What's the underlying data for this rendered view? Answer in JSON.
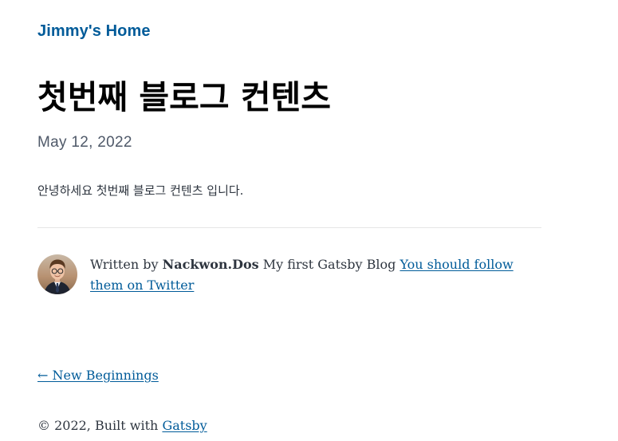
{
  "header": {
    "site_title": "Jimmy's Home"
  },
  "post": {
    "title": "첫번째 블로그 컨텐츠",
    "date": "May 12, 2022",
    "body": "안녕하세요 첫번째 블로그 컨텐츠 입니다."
  },
  "bio": {
    "avatar_icon": "author-avatar",
    "written_by": "Written by",
    "author": "Nackwon.Dos",
    "description": "My first Gatsby Blog",
    "twitter_link": "You should follow them on Twitter"
  },
  "nav": {
    "prev_link": "← New Beginnings"
  },
  "footer": {
    "copyright": "© 2022, Built with",
    "gatsby_link": "Gatsby"
  },
  "colors": {
    "link": "#005b99",
    "text": "#2e353f",
    "divider": "#e5e5e5"
  }
}
